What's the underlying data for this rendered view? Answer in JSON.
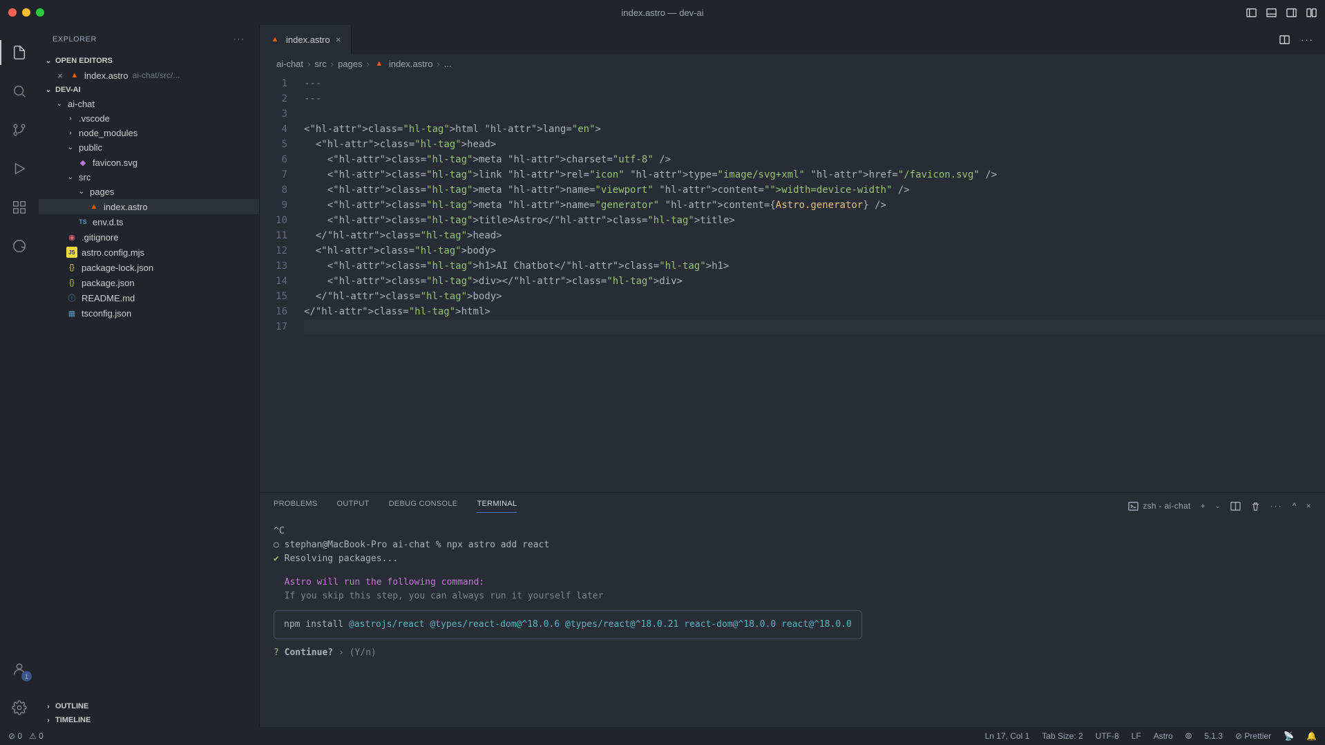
{
  "titlebar": {
    "title": "index.astro — dev-ai"
  },
  "sidebar": {
    "title": "EXPLORER",
    "open_editors_label": "OPEN EDITORS",
    "open_editors": [
      {
        "name": "index.astro",
        "path": "ai-chat/src/..."
      }
    ],
    "workspace": "DEV-AI",
    "tree": {
      "root": "ai-chat",
      "vscode": ".vscode",
      "node_modules": "node_modules",
      "public": "public",
      "favicon": "favicon.svg",
      "src": "src",
      "pages": "pages",
      "index_astro": "index.astro",
      "env_d_ts": "env.d.ts",
      "gitignore": ".gitignore",
      "astro_config": "astro.config.mjs",
      "package_lock": "package-lock.json",
      "package_json": "package.json",
      "readme": "README.md",
      "tsconfig": "tsconfig.json"
    },
    "outline": "OUTLINE",
    "timeline": "TIMELINE"
  },
  "tabs": {
    "active": "index.astro"
  },
  "breadcrumbs": {
    "p0": "ai-chat",
    "p1": "src",
    "p2": "pages",
    "p3": "index.astro",
    "p4": "..."
  },
  "code": {
    "line_count": 17,
    "lines": [
      "---",
      "---",
      "",
      "<html lang=\"en\">",
      "  <head>",
      "    <meta charset=\"utf-8\" />",
      "    <link rel=\"icon\" type=\"image/svg+xml\" href=\"/favicon.svg\" />",
      "    <meta name=\"viewport\" content=\"width=device-width\" />",
      "    <meta name=\"generator\" content={Astro.generator} />",
      "    <title>Astro</title>",
      "  </head>",
      "  <body>",
      "    <h1>AI Chatbot</h1>",
      "    <div></div>",
      "  </body>",
      "</html>",
      ""
    ]
  },
  "panel": {
    "problems": "PROBLEMS",
    "output": "OUTPUT",
    "debug_console": "DEBUG CONSOLE",
    "terminal": "TERMINAL",
    "shell": "zsh - ai-chat"
  },
  "terminal": {
    "l1": "^C",
    "prompt": "stephan@MacBook-Pro ai-chat %",
    "cmd": "npx astro add react",
    "resolving": "Resolving packages...",
    "willrun": "Astro will run the following command:",
    "skip": "If you skip this step, you can always run it yourself later",
    "box_cmd": "npm install",
    "box_pkgs": "@astrojs/react @types/react-dom@^18.0.6 @types/react@^18.0.21 react-dom@^18.0.0 react@^18.0.0",
    "continue_q": "?",
    "continue_txt": "Continue?",
    "continue_hint": "› (Y/n)"
  },
  "statusbar": {
    "errors": "0",
    "warnings": "0",
    "cursor": "Ln 17, Col 1",
    "tabsize": "Tab Size: 2",
    "encoding": "UTF-8",
    "eol": "LF",
    "lang": "Astro",
    "ver": "5.1.3",
    "prettier": "Prettier"
  },
  "activity": {
    "account_badge": "1"
  }
}
